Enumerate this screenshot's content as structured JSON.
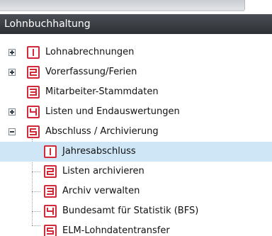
{
  "panel": {
    "title": "Lohnbuchhaltung"
  },
  "tree": {
    "items": [
      {
        "label": "Lohnabrechnungen",
        "icon": "number-1-icon"
      },
      {
        "label": "Vorerfassung/Ferien",
        "icon": "number-2-icon"
      },
      {
        "label": "Mitarbeiter-Stammdaten",
        "icon": "number-3-icon"
      },
      {
        "label": "Listen und Endauswertungen",
        "icon": "number-4-icon"
      },
      {
        "label": "Abschluss / Archivierung",
        "icon": "number-5-icon"
      }
    ],
    "children": [
      {
        "label": "Jahresabschluss",
        "icon": "number-1-icon"
      },
      {
        "label": "Listen archivieren",
        "icon": "number-2-icon"
      },
      {
        "label": "Archiv verwalten",
        "icon": "number-3-icon"
      },
      {
        "label": "Bundesamt für Statistik (BFS)",
        "icon": "number-4-icon"
      },
      {
        "label": "ELM-Lohndatentransfer",
        "icon": "number-5-icon"
      }
    ]
  },
  "colors": {
    "icon_red": "#d22a3a",
    "selection": "#cfe6f6",
    "titlebar": "#3a3e44"
  }
}
